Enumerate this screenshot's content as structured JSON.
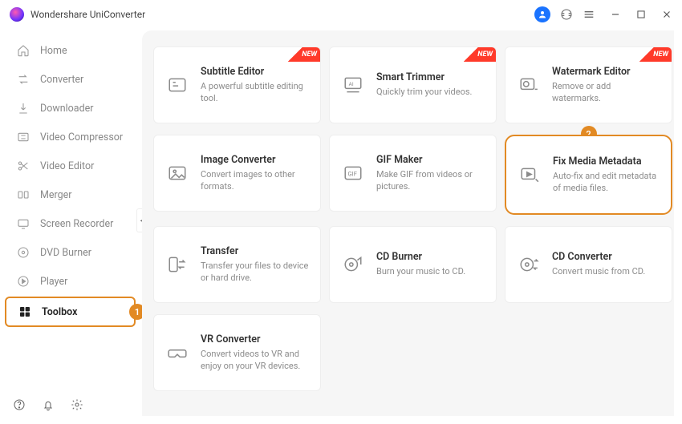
{
  "app": {
    "title": "Wondershare UniConverter"
  },
  "sidebar": {
    "items": [
      {
        "label": "Home"
      },
      {
        "label": "Converter"
      },
      {
        "label": "Downloader"
      },
      {
        "label": "Video Compressor"
      },
      {
        "label": "Video Editor"
      },
      {
        "label": "Merger"
      },
      {
        "label": "Screen Recorder"
      },
      {
        "label": "DVD Burner"
      },
      {
        "label": "Player"
      },
      {
        "label": "Toolbox"
      }
    ]
  },
  "annotations": {
    "step1": "1",
    "step2": "2"
  },
  "ribbon": {
    "new": "NEW"
  },
  "cards": [
    {
      "title": "Subtitle Editor",
      "desc": "A powerful subtitle editing tool.",
      "new": true
    },
    {
      "title": "Smart Trimmer",
      "desc": "Quickly trim your videos.",
      "new": true
    },
    {
      "title": "Watermark Editor",
      "desc": "Remove or add watermarks.",
      "new": true
    },
    {
      "title": "Image Converter",
      "desc": "Convert images to other formats."
    },
    {
      "title": "GIF Maker",
      "desc": "Make GIF from videos or pictures."
    },
    {
      "title": "Fix Media Metadata",
      "desc": "Auto-fix and edit metadata of media files.",
      "highlight": true
    },
    {
      "title": "Transfer",
      "desc": "Transfer your files to device or hard drive."
    },
    {
      "title": "CD Burner",
      "desc": "Burn your music to CD."
    },
    {
      "title": "CD Converter",
      "desc": "Convert music from CD."
    },
    {
      "title": "VR Converter",
      "desc": "Convert videos to VR and enjoy on your VR devices."
    }
  ]
}
